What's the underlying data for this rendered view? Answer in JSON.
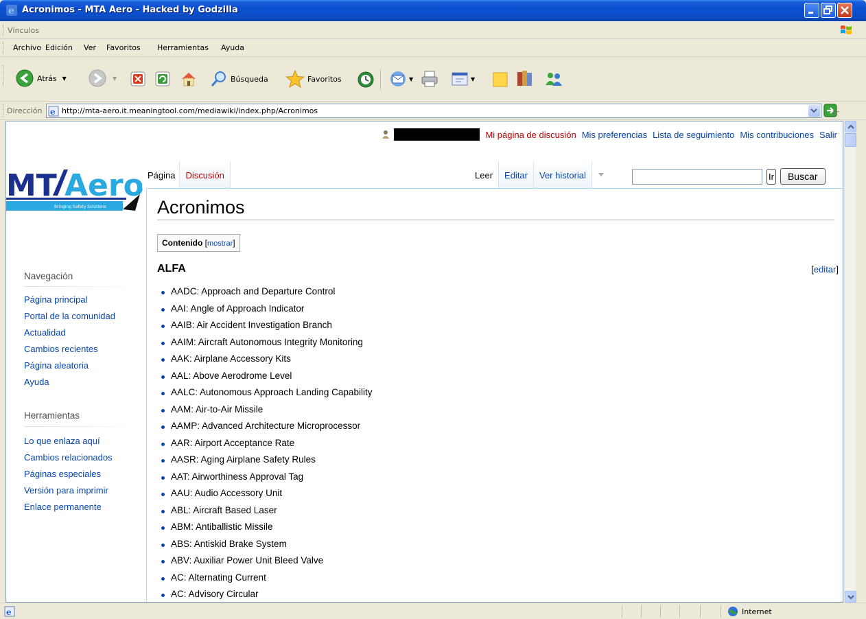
{
  "window": {
    "title": "Acronimos - MTA Aero - Hacked by Godzilla"
  },
  "links_bar": {
    "label": "Vínculos"
  },
  "menu": [
    "Archivo",
    "Edición",
    "Ver",
    "Favoritos",
    "Herramientas",
    "Ayuda"
  ],
  "toolbar": {
    "back": "Atrás",
    "search": "Búsqueda",
    "favorites": "Favoritos"
  },
  "address": {
    "label": "Dirección",
    "url": "http://mta-aero.it.meaningtool.com/mediawiki/index.php/Acronimos",
    "go": "Ir"
  },
  "personal": {
    "talk": "Mi página de discusión",
    "prefs": "Mis preferencias",
    "watchlist": "Lista de seguimiento",
    "contribs": "Mis contribuciones",
    "logout": "Salir"
  },
  "tabs": {
    "page": "Página",
    "discussion": "Discusión",
    "read": "Leer",
    "edit": "Editar",
    "history": "Ver historial"
  },
  "search": {
    "go": "Ir",
    "button": "Buscar"
  },
  "logo": {
    "text": "MTAero",
    "tagline": "Bringing Safety Solutions"
  },
  "page": {
    "title": "Acronimos",
    "toc_title": "Contenido",
    "toc_toggle": "mostrar",
    "section": "ALFA",
    "edit_link": "editar"
  },
  "acronyms": [
    "AADC: Approach and Departure Control",
    "AAI: Angle of Approach Indicator",
    "AAIB: Air Accident Investigation Branch",
    "AAIM: Aircraft Autonomous Integrity Monitoring",
    "AAK: Airplane Accessory Kits",
    "AAL: Above Aerodrome Level",
    "AALC: Autonomous Approach Landing Capability",
    "AAM: Air-to-Air Missile",
    "AAMP: Advanced Architecture Microprocessor",
    "AAR: Airport Acceptance Rate",
    "AASR: Aging Airplane Safety Rules",
    "AAT: Airworthiness Approval Tag",
    "AAU: Audio Accessory Unit",
    "ABL: Aircraft Based Laser",
    "ABM: Antiballistic Missile",
    "ABS: Antiskid Brake System",
    "ABV: Auxiliar Power Unit Bleed Valve",
    "AC: Alternating Current",
    "AC: Advisory Circular"
  ],
  "sidebar": {
    "nav_heading": "Navegación",
    "nav": [
      "Página principal",
      "Portal de la comunidad",
      "Actualidad",
      "Cambios recientes",
      "Página aleatoria",
      "Ayuda"
    ],
    "tools_heading": "Herramientas",
    "tools": [
      "Lo que enlaza aquí",
      "Cambios relacionados",
      "Páginas especiales",
      "Versión para imprimir",
      "Enlace permanente"
    ]
  },
  "status": {
    "zone": "Internet"
  },
  "colors": {
    "link": "#0645ad",
    "redlink": "#ba0000",
    "titlebar": "#0a4fd0",
    "chrome": "#ece9d8"
  }
}
